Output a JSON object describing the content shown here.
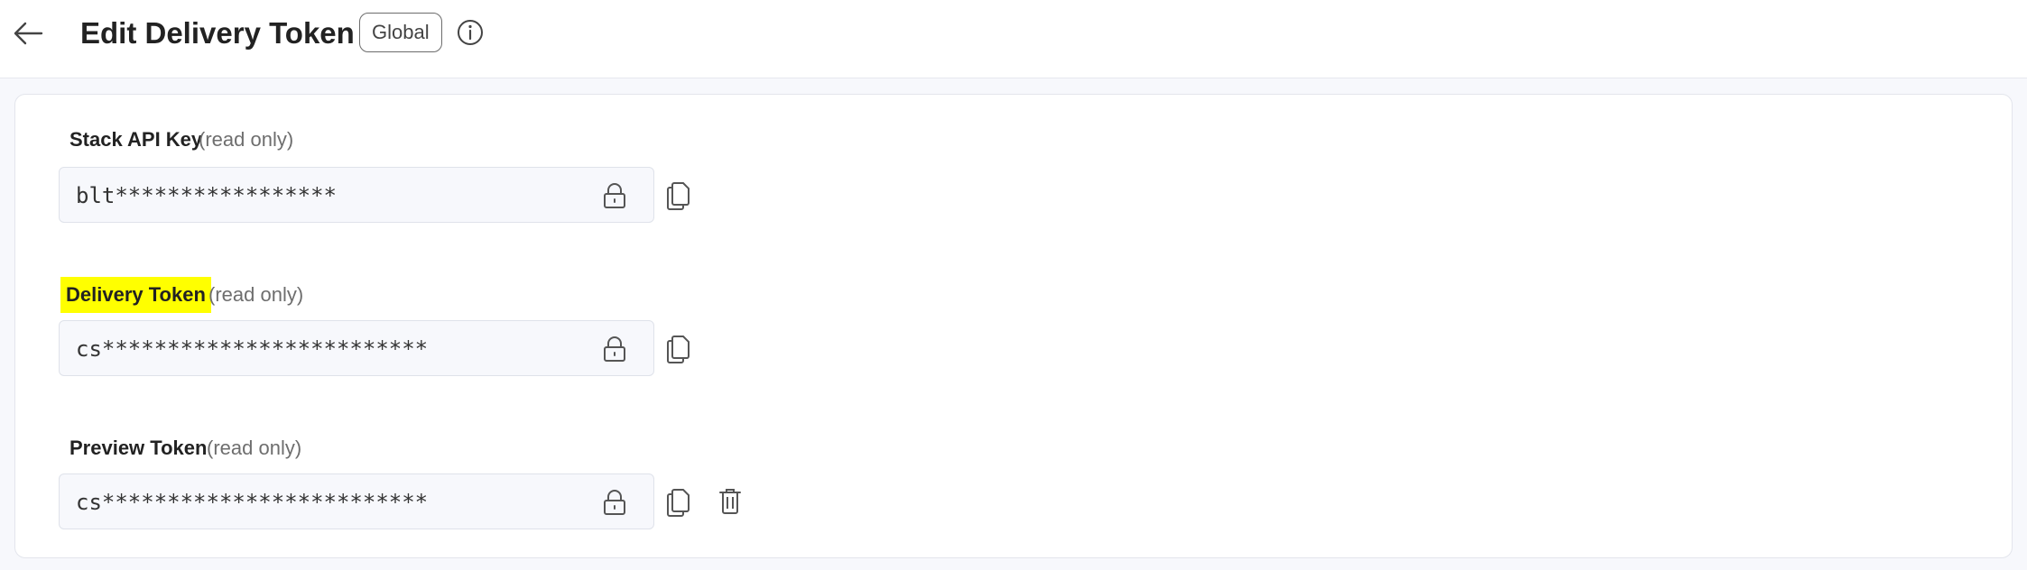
{
  "header": {
    "title": "Edit Delivery Token",
    "scope_badge": "Global",
    "icons": {
      "back": "arrow-left-icon",
      "info": "info-icon"
    }
  },
  "fields": [
    {
      "label": "Stack API Key",
      "note": "(read only)",
      "value": "blt*****************",
      "highlighted": false
    },
    {
      "label": "Delivery Token",
      "note": "(read only)",
      "value": "cs*************************",
      "highlighted": true
    },
    {
      "label": "Preview Token",
      "note": "(read only)",
      "value": "cs*************************",
      "highlighted": false
    }
  ],
  "colors": {
    "highlight": "#ffff00",
    "field_bg": "#f7f8fc",
    "page_bg": "#f7f8fc"
  }
}
